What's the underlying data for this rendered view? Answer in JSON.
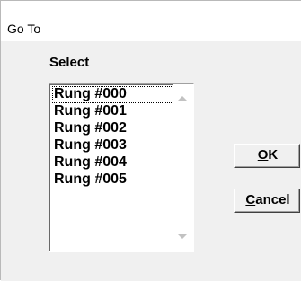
{
  "window": {
    "title": "Go To"
  },
  "dialog": {
    "select_label": "Select",
    "list_items": [
      "Rung #000",
      "Rung #001",
      "Rung #002",
      "Rung #003",
      "Rung #004",
      "Rung #005"
    ],
    "selected_index": 0,
    "ok": {
      "mnemonic": "O",
      "rest": "K"
    },
    "cancel": {
      "mnemonic": "C",
      "rest": "ancel"
    }
  },
  "icons": {
    "scroll_up": "scroll-up-arrow-icon",
    "scroll_down": "scroll-down-arrow-icon"
  }
}
